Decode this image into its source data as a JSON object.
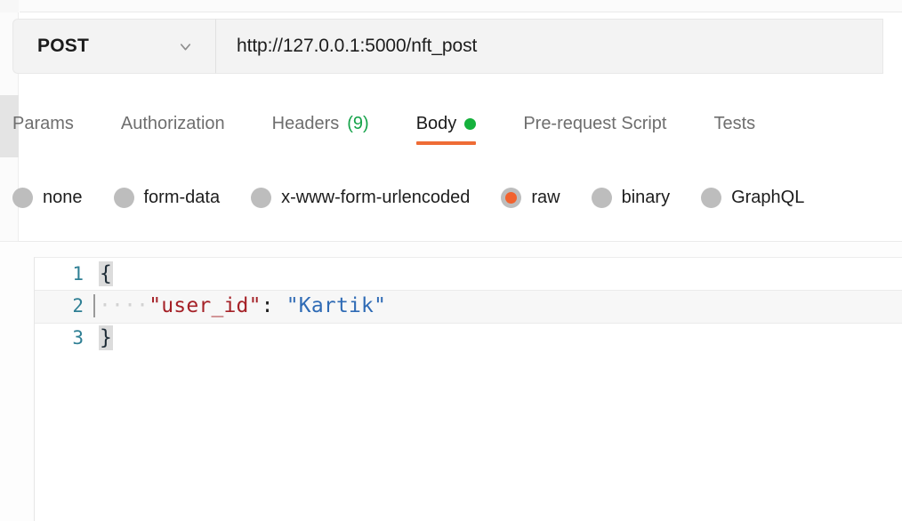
{
  "request": {
    "method": "POST",
    "method_dropdown_icon": "chevron-down-icon",
    "url": "http://127.0.0.1:5000/nft_post",
    "url_placeholder": "Enter request URL"
  },
  "tabs": [
    {
      "label": "Params",
      "active": false,
      "count": "",
      "dot": false
    },
    {
      "label": "Authorization",
      "active": false,
      "count": "",
      "dot": false
    },
    {
      "label": "Headers",
      "active": false,
      "count": "(9)",
      "dot": false
    },
    {
      "label": "Body",
      "active": true,
      "count": "",
      "dot": true
    },
    {
      "label": "Pre-request Script",
      "active": false,
      "count": "",
      "dot": false
    },
    {
      "label": "Tests",
      "active": false,
      "count": "",
      "dot": false
    }
  ],
  "body_types": [
    {
      "label": "none",
      "selected": false
    },
    {
      "label": "form-data",
      "selected": false
    },
    {
      "label": "x-www-form-urlencoded",
      "selected": false
    },
    {
      "label": "raw",
      "selected": true
    },
    {
      "label": "binary",
      "selected": false
    },
    {
      "label": "GraphQL",
      "selected": false
    }
  ],
  "editor": {
    "lines": [
      {
        "number": "1",
        "open_brace": "{",
        "indent": "",
        "key": "",
        "colon": "",
        "value": "",
        "close_brace": "",
        "active": false
      },
      {
        "number": "2",
        "open_brace": "",
        "indent": "····",
        "key": "\"user_id\"",
        "colon": ":",
        "value": " \"Kartik\"",
        "close_brace": "",
        "active": true
      },
      {
        "number": "3",
        "open_brace": "}",
        "indent": "",
        "key": "",
        "colon": "",
        "value": "",
        "close_brace": "",
        "active": false
      }
    ]
  },
  "colors": {
    "accent_orange": "#ef6c35",
    "status_green": "#15b13c",
    "header_count_green": "#16a34a",
    "json_key_red": "#a52127",
    "json_string_blue": "#2f6bb5",
    "line_number_teal": "#2f7f94",
    "field_background": "#f3f3f3"
  }
}
